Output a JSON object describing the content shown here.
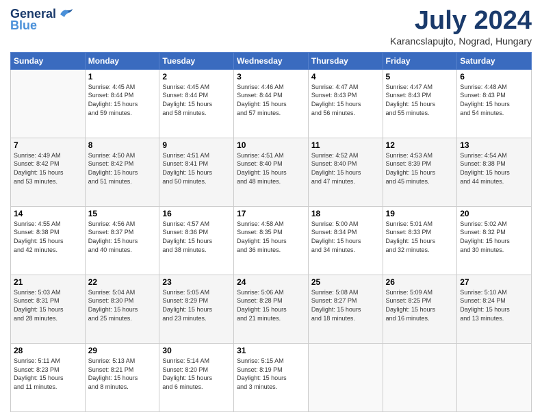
{
  "header": {
    "logo_general": "General",
    "logo_blue": "Blue",
    "month": "July 2024",
    "location": "Karancslapujto, Nograd, Hungary"
  },
  "weekdays": [
    "Sunday",
    "Monday",
    "Tuesday",
    "Wednesday",
    "Thursday",
    "Friday",
    "Saturday"
  ],
  "weeks": [
    [
      {
        "day": "",
        "info": ""
      },
      {
        "day": "1",
        "info": "Sunrise: 4:45 AM\nSunset: 8:44 PM\nDaylight: 15 hours\nand 59 minutes."
      },
      {
        "day": "2",
        "info": "Sunrise: 4:45 AM\nSunset: 8:44 PM\nDaylight: 15 hours\nand 58 minutes."
      },
      {
        "day": "3",
        "info": "Sunrise: 4:46 AM\nSunset: 8:44 PM\nDaylight: 15 hours\nand 57 minutes."
      },
      {
        "day": "4",
        "info": "Sunrise: 4:47 AM\nSunset: 8:43 PM\nDaylight: 15 hours\nand 56 minutes."
      },
      {
        "day": "5",
        "info": "Sunrise: 4:47 AM\nSunset: 8:43 PM\nDaylight: 15 hours\nand 55 minutes."
      },
      {
        "day": "6",
        "info": "Sunrise: 4:48 AM\nSunset: 8:43 PM\nDaylight: 15 hours\nand 54 minutes."
      }
    ],
    [
      {
        "day": "7",
        "info": "Sunrise: 4:49 AM\nSunset: 8:42 PM\nDaylight: 15 hours\nand 53 minutes."
      },
      {
        "day": "8",
        "info": "Sunrise: 4:50 AM\nSunset: 8:42 PM\nDaylight: 15 hours\nand 51 minutes."
      },
      {
        "day": "9",
        "info": "Sunrise: 4:51 AM\nSunset: 8:41 PM\nDaylight: 15 hours\nand 50 minutes."
      },
      {
        "day": "10",
        "info": "Sunrise: 4:51 AM\nSunset: 8:40 PM\nDaylight: 15 hours\nand 48 minutes."
      },
      {
        "day": "11",
        "info": "Sunrise: 4:52 AM\nSunset: 8:40 PM\nDaylight: 15 hours\nand 47 minutes."
      },
      {
        "day": "12",
        "info": "Sunrise: 4:53 AM\nSunset: 8:39 PM\nDaylight: 15 hours\nand 45 minutes."
      },
      {
        "day": "13",
        "info": "Sunrise: 4:54 AM\nSunset: 8:38 PM\nDaylight: 15 hours\nand 44 minutes."
      }
    ],
    [
      {
        "day": "14",
        "info": "Sunrise: 4:55 AM\nSunset: 8:38 PM\nDaylight: 15 hours\nand 42 minutes."
      },
      {
        "day": "15",
        "info": "Sunrise: 4:56 AM\nSunset: 8:37 PM\nDaylight: 15 hours\nand 40 minutes."
      },
      {
        "day": "16",
        "info": "Sunrise: 4:57 AM\nSunset: 8:36 PM\nDaylight: 15 hours\nand 38 minutes."
      },
      {
        "day": "17",
        "info": "Sunrise: 4:58 AM\nSunset: 8:35 PM\nDaylight: 15 hours\nand 36 minutes."
      },
      {
        "day": "18",
        "info": "Sunrise: 5:00 AM\nSunset: 8:34 PM\nDaylight: 15 hours\nand 34 minutes."
      },
      {
        "day": "19",
        "info": "Sunrise: 5:01 AM\nSunset: 8:33 PM\nDaylight: 15 hours\nand 32 minutes."
      },
      {
        "day": "20",
        "info": "Sunrise: 5:02 AM\nSunset: 8:32 PM\nDaylight: 15 hours\nand 30 minutes."
      }
    ],
    [
      {
        "day": "21",
        "info": "Sunrise: 5:03 AM\nSunset: 8:31 PM\nDaylight: 15 hours\nand 28 minutes."
      },
      {
        "day": "22",
        "info": "Sunrise: 5:04 AM\nSunset: 8:30 PM\nDaylight: 15 hours\nand 25 minutes."
      },
      {
        "day": "23",
        "info": "Sunrise: 5:05 AM\nSunset: 8:29 PM\nDaylight: 15 hours\nand 23 minutes."
      },
      {
        "day": "24",
        "info": "Sunrise: 5:06 AM\nSunset: 8:28 PM\nDaylight: 15 hours\nand 21 minutes."
      },
      {
        "day": "25",
        "info": "Sunrise: 5:08 AM\nSunset: 8:27 PM\nDaylight: 15 hours\nand 18 minutes."
      },
      {
        "day": "26",
        "info": "Sunrise: 5:09 AM\nSunset: 8:25 PM\nDaylight: 15 hours\nand 16 minutes."
      },
      {
        "day": "27",
        "info": "Sunrise: 5:10 AM\nSunset: 8:24 PM\nDaylight: 15 hours\nand 13 minutes."
      }
    ],
    [
      {
        "day": "28",
        "info": "Sunrise: 5:11 AM\nSunset: 8:23 PM\nDaylight: 15 hours\nand 11 minutes."
      },
      {
        "day": "29",
        "info": "Sunrise: 5:13 AM\nSunset: 8:21 PM\nDaylight: 15 hours\nand 8 minutes."
      },
      {
        "day": "30",
        "info": "Sunrise: 5:14 AM\nSunset: 8:20 PM\nDaylight: 15 hours\nand 6 minutes."
      },
      {
        "day": "31",
        "info": "Sunrise: 5:15 AM\nSunset: 8:19 PM\nDaylight: 15 hours\nand 3 minutes."
      },
      {
        "day": "",
        "info": ""
      },
      {
        "day": "",
        "info": ""
      },
      {
        "day": "",
        "info": ""
      }
    ]
  ]
}
